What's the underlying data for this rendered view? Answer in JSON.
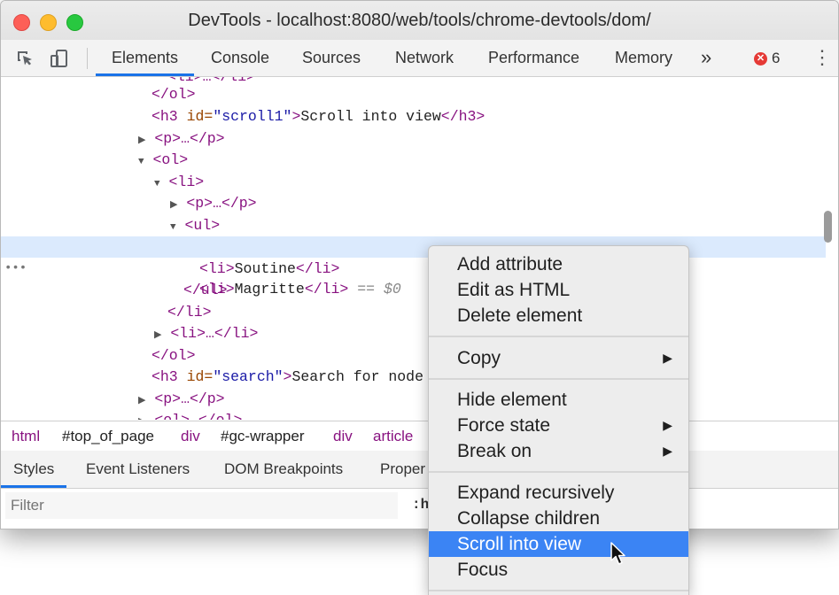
{
  "window": {
    "title": "DevTools - localhost:8080/web/tools/chrome-devtools/dom/"
  },
  "toolbar": {
    "tabs": [
      "Elements",
      "Console",
      "Sources",
      "Network",
      "Performance",
      "Memory"
    ],
    "more": "»",
    "error_count": "6",
    "error_icon": "✕"
  },
  "dom": {
    "top_partial": "<li>…</li>",
    "rows": {
      "r1_close": "</ol>",
      "r2_open": "<h3 ",
      "r2_attr": "id=",
      "r2_val": "\"scroll1\"",
      "r2_gt": ">",
      "r2_text": "Scroll into view",
      "r2_close": "</h3>",
      "r3": "<p>…</p>",
      "r4": "<ol>",
      "r5": "<li>",
      "r6": "<p>…</p>",
      "r7": "<ul>",
      "r8_open": "<li>",
      "r8_text": "Magritte",
      "r8_close": "</li>",
      "r8_eq": " == $0",
      "r9_open": "<li>",
      "r9_text": "Soutine",
      "r9_close": "</li>",
      "r10": "</ul>",
      "r11": "</li>",
      "r12": "<li>…</li>",
      "r13": "</ol>",
      "r14_open": "<h3 ",
      "r14_attr": "id=",
      "r14_val": "\"search\"",
      "r14_gt": ">",
      "r14_text": "Search for node",
      "r15": "<p>…</p>",
      "r16": "<ol>…</ol>"
    },
    "ellipsis": "•••"
  },
  "breadcrumbs": [
    "html",
    "#top_of_page",
    "div",
    "#gc-wrapper",
    "div",
    "article"
  ],
  "subtabs": [
    "Styles",
    "Event Listeners",
    "DOM Breakpoints",
    "Proper"
  ],
  "filter": {
    "placeholder": "Filter",
    "hov_label": ":h"
  },
  "context_menu": {
    "items": [
      "Add attribute",
      "Edit as HTML",
      "Delete element",
      "Copy",
      "Hide element",
      "Force state",
      "Break on",
      "Expand recursively",
      "Collapse children",
      "Scroll into view",
      "Focus"
    ],
    "submenu_arrow": "▶"
  }
}
